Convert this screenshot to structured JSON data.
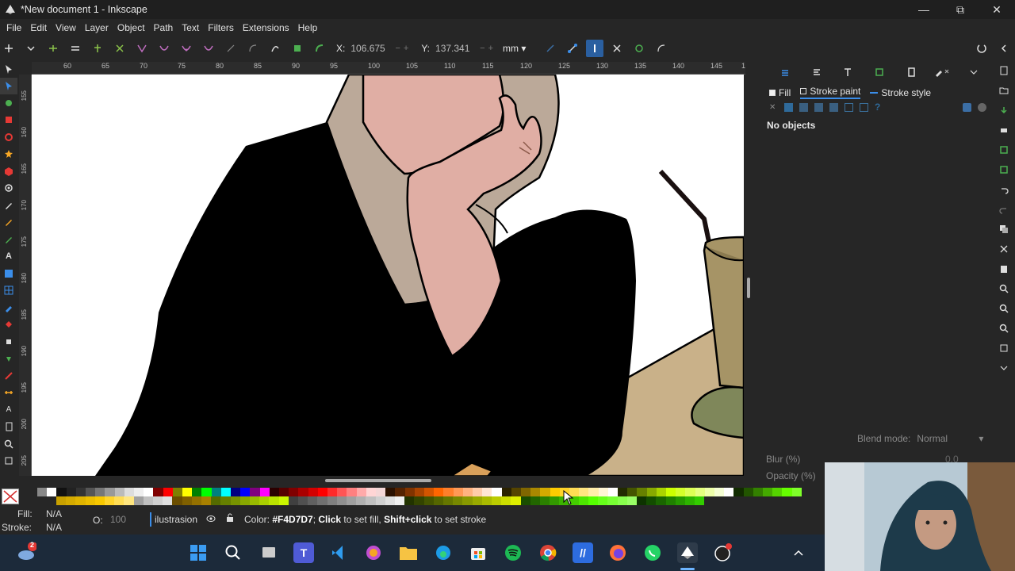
{
  "window": {
    "title": "*New document 1 - Inkscape",
    "minimize_icon": "minimize-icon",
    "restore_icon": "restore-icon",
    "close_icon": "close-icon"
  },
  "menu": [
    "File",
    "Edit",
    "View",
    "Layer",
    "Object",
    "Path",
    "Text",
    "Filters",
    "Extensions",
    "Help"
  ],
  "tool_controls": {
    "x_label": "X:",
    "x_value": "106.675",
    "y_label": "Y:",
    "y_value": "137.341",
    "unit": "mm"
  },
  "ruler": {
    "h_ticks": [
      "60",
      "65",
      "70",
      "75",
      "80",
      "85",
      "90",
      "95",
      "100",
      "105",
      "110",
      "115",
      "120",
      "125",
      "130",
      "135",
      "140",
      "145",
      "150"
    ],
    "v_ticks": [
      "155",
      "160",
      "165",
      "170",
      "175",
      "180",
      "185",
      "190",
      "195",
      "200",
      "205"
    ]
  },
  "dock": {
    "tab_fill": "Fill",
    "tab_stroke_paint": "Stroke paint",
    "tab_stroke_style": "Stroke style",
    "no_objects": "No objects",
    "blend_label": "Blend mode:",
    "blend_value": "Normal",
    "blur_label": "Blur (%)",
    "blur_value": "0.0",
    "opacity_label": "Opacity (%)"
  },
  "status": {
    "fill_label": "Fill:",
    "fill_value": "N/A",
    "stroke_label": "Stroke:",
    "stroke_value": "N/A",
    "opacity_label": "O:",
    "opacity_value": "100",
    "layer_name": "ilustrasion",
    "msg_prefix": "Color: ",
    "msg_color": "#F4D7D7",
    "msg_mid1": "; ",
    "msg_click": "Click",
    "msg_mid2": " to set fill, ",
    "msg_shift": "Shift+click",
    "msg_end": " to set stroke"
  },
  "taskbar": {
    "notification_count": "2"
  },
  "colors": {
    "accent": "#3b8eea",
    "skin": "#e0aea4",
    "hijab": "#bba999",
    "shirt": "#000000",
    "table": "#c9b189",
    "cup": "#a69466"
  }
}
